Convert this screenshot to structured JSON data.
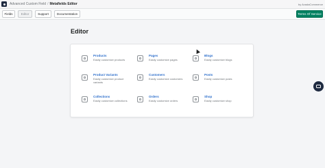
{
  "header": {
    "breadcrumb_app": "Advanced Custom Field",
    "breadcrumb_sep": "/",
    "breadcrumb_current": "Metafields Editor",
    "byline": "by AvadaCommerce"
  },
  "toolbar": {
    "fields": "Fields",
    "editor": "Editor",
    "support": "Support",
    "documentation": "Documentation",
    "terms": "Terms Of Service"
  },
  "main": {
    "title": "Editor",
    "items": [
      {
        "name": "Products",
        "desc": "Easily customize products",
        "icon": "tag-icon"
      },
      {
        "name": "Pages",
        "desc": "Easily customize pages",
        "icon": "page-icon"
      },
      {
        "name": "Blogs",
        "desc": "Easily customize blogs",
        "icon": "blog-icon"
      },
      {
        "name": "Product Variants",
        "desc": "Easily customize product variants",
        "icon": "variant-icon"
      },
      {
        "name": "Customers",
        "desc": "Easily customize customers",
        "icon": "person-icon"
      },
      {
        "name": "Posts",
        "desc": "Easily customize posts",
        "icon": "post-icon"
      },
      {
        "name": "Collections",
        "desc": "Easily customize collections",
        "icon": "collection-icon"
      },
      {
        "name": "Orders",
        "desc": "Easily customize orders",
        "icon": "order-icon"
      },
      {
        "name": "Shop",
        "desc": "Easily customize shop",
        "icon": "shop-icon"
      }
    ]
  },
  "colors": {
    "primary": "#008060",
    "link": "#2c6ecb",
    "chat": "#1e2a40"
  }
}
